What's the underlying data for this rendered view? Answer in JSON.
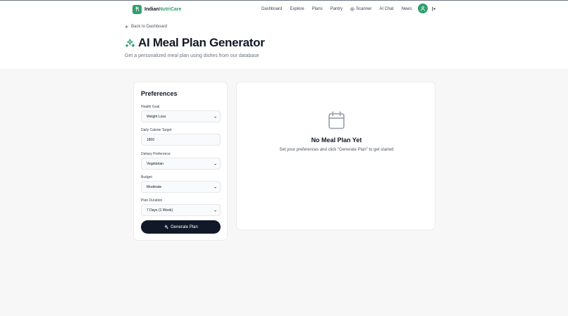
{
  "brand": {
    "name_part1": "Indian",
    "name_part2": "NutriCare",
    "accent_color": "#2f9e6e",
    "logo_icon": "utensils-icon"
  },
  "nav": {
    "links": [
      "Dashboard",
      "Explore",
      "Plans",
      "Pantry",
      "Scanner",
      "AI Chat",
      "News"
    ],
    "scanner_icon": "scan-icon",
    "avatar_icon": "user-icon",
    "logout_icon": "logout-icon"
  },
  "page": {
    "back_label": "Back to Dashboard",
    "title": "AI Meal Plan Generator",
    "title_icon": "sparkles-icon",
    "subtitle": "Get a personalized meal plan using dishes from our database"
  },
  "preferences": {
    "title": "Preferences",
    "health_goal": {
      "label": "Health Goal",
      "value": "Weight Loss"
    },
    "calorie_target": {
      "label": "Daily Calorie Target",
      "value": "1800"
    },
    "dietary_preference": {
      "label": "Dietary Preference",
      "value": "Vegetarian"
    },
    "budget": {
      "label": "Budget",
      "value": "Moderate"
    },
    "plan_duration": {
      "label": "Plan Duration",
      "value": "7 Days (1 Week)"
    },
    "generate_label": "Generate Plan"
  },
  "result": {
    "icon": "calendar-icon",
    "title": "No Meal Plan Yet",
    "description": "Set your preferences and click \"Generate Plan\" to get started"
  }
}
